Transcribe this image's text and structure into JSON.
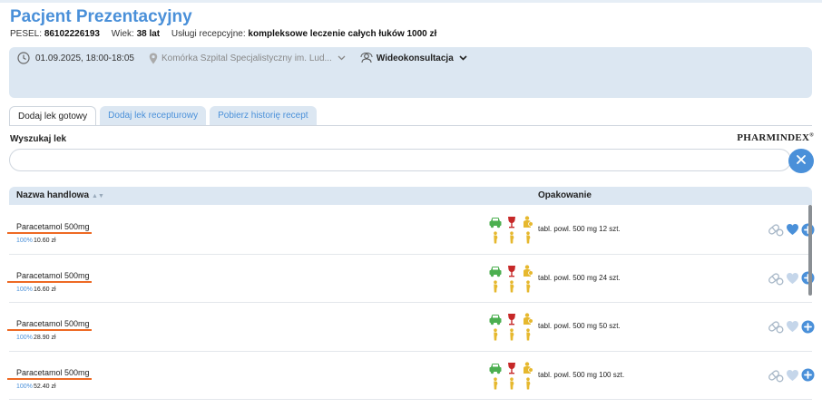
{
  "patient": {
    "name": "Pacjent Prezentacyjny",
    "pesel_label": "PESEL:",
    "pesel": "86102226193",
    "age_label": "Wiek:",
    "age": "38 lat",
    "services_label": "Usługi recepcyjne:",
    "services": "kompleksowe leczenie całych łuków 1000 zł"
  },
  "visit": {
    "datetime": "01.09.2025, 18:00-18:05",
    "location": "Komórka Szpital Specjalistyczny im. Lud...",
    "type": "Wideokonsultacja"
  },
  "tabs": [
    {
      "label": "Dodaj lek gotowy",
      "active": true
    },
    {
      "label": "Dodaj lek recepturowy",
      "active": false
    },
    {
      "label": "Pobierz historię recept",
      "active": false
    }
  ],
  "search": {
    "label": "Wyszukaj lek",
    "value": "",
    "placeholder": "",
    "brand": "PHARMINDEX"
  },
  "table": {
    "columns": {
      "name": "Nazwa handlowa",
      "package": "Opakowanie"
    },
    "rows": [
      {
        "name": "Paracetamol 500mg",
        "refund": "100%",
        "price": "10.60 zł",
        "package": "tabl. powl. 500 mg 12 szt.",
        "favorite": true
      },
      {
        "name": "Paracetamol 500mg",
        "refund": "100%",
        "price": "16.60 zł",
        "package": "tabl. powl. 500 mg 24 szt.",
        "favorite": false
      },
      {
        "name": "Paracetamol 500mg",
        "refund": "100%",
        "price": "28.90 zł",
        "package": "tabl. powl. 500 mg 50 szt.",
        "favorite": false
      },
      {
        "name": "Paracetamol 500mg",
        "refund": "100%",
        "price": "52.40 zł",
        "package": "tabl. powl. 500 mg 100 szt.",
        "favorite": false
      }
    ]
  },
  "colors": {
    "accent": "#4a90d9",
    "panel": "#dce7f2",
    "underline": "#ee6a24",
    "icon_green": "#4caf50",
    "icon_red": "#c62828",
    "icon_yellow": "#e6b82e",
    "favorite_active": "#4a90d9",
    "favorite_inactive": "#c5d6ea"
  },
  "icons": {
    "clock": "clock-icon",
    "location": "location-pin-icon",
    "video": "video-consult-icon",
    "clear": "close-icon",
    "driving": "car-icon",
    "alcohol": "wine-glass-icon",
    "breastfeeding": "breastfeeding-icon",
    "pregnancy": "pregnancy-icon",
    "substitutes": "pills-icon",
    "favorite": "heart-icon",
    "add": "plus-icon"
  }
}
